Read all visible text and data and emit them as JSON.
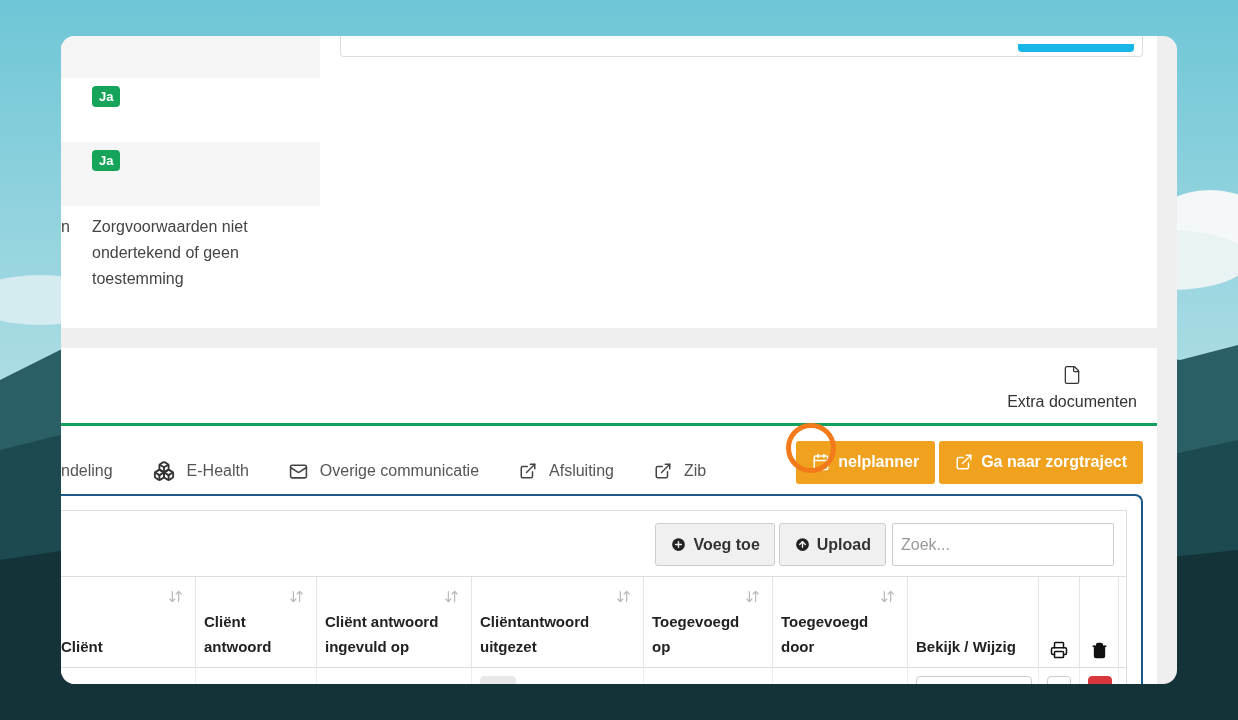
{
  "detail_rows": [
    {
      "kind": "blank"
    },
    {
      "kind": "badge",
      "text": "Ja"
    },
    {
      "kind": "badge",
      "text": "Ja"
    },
    {
      "kind": "text",
      "label": "n",
      "text": "Zorgvoorwaarden niet ondertekend of geen toestemming"
    }
  ],
  "extra_documents": {
    "label": "Extra documenten"
  },
  "tabs": [
    {
      "kind": "plain",
      "label": "ndeling",
      "selected": false
    },
    {
      "kind": "boxes",
      "label": "E-Health",
      "selected": false
    },
    {
      "kind": "mail",
      "label": "Overige communicatie",
      "selected": false
    },
    {
      "kind": "external",
      "label": "Afsluiting",
      "selected": false
    },
    {
      "kind": "external",
      "label": "Zib",
      "selected": false
    }
  ],
  "action_buttons": [
    {
      "kind": "calendar",
      "label": "nelplanner",
      "highlighted": true
    },
    {
      "kind": "external",
      "label": "Ga naar zorgtraject",
      "highlighted": false
    }
  ],
  "toolbar": {
    "buttons": [
      {
        "kind": "add",
        "label": "Voeg toe"
      },
      {
        "kind": "upload",
        "label": "Upload"
      }
    ],
    "search": {
      "placeholder": "Zoek..."
    }
  },
  "table": {
    "columns": [
      {
        "kind": "text",
        "label": "Cliënt",
        "sortable": true
      },
      {
        "kind": "text",
        "label": "Cliënt antwoord",
        "sortable": true
      },
      {
        "kind": "text",
        "label": "Cliënt antwoord ingevuld op",
        "sortable": true
      },
      {
        "kind": "text",
        "label": "Cliëntantwoord uitgezet",
        "sortable": true
      },
      {
        "kind": "text",
        "label": "Toegevoegd op",
        "sortable": true
      },
      {
        "kind": "text",
        "label": "Toegevoegd door",
        "sortable": true
      },
      {
        "kind": "text",
        "label": "Bekijk / Wijzig",
        "sortable": false
      },
      {
        "kind": "print",
        "sortable": false
      },
      {
        "kind": "delete",
        "sortable": false
      }
    ]
  }
}
